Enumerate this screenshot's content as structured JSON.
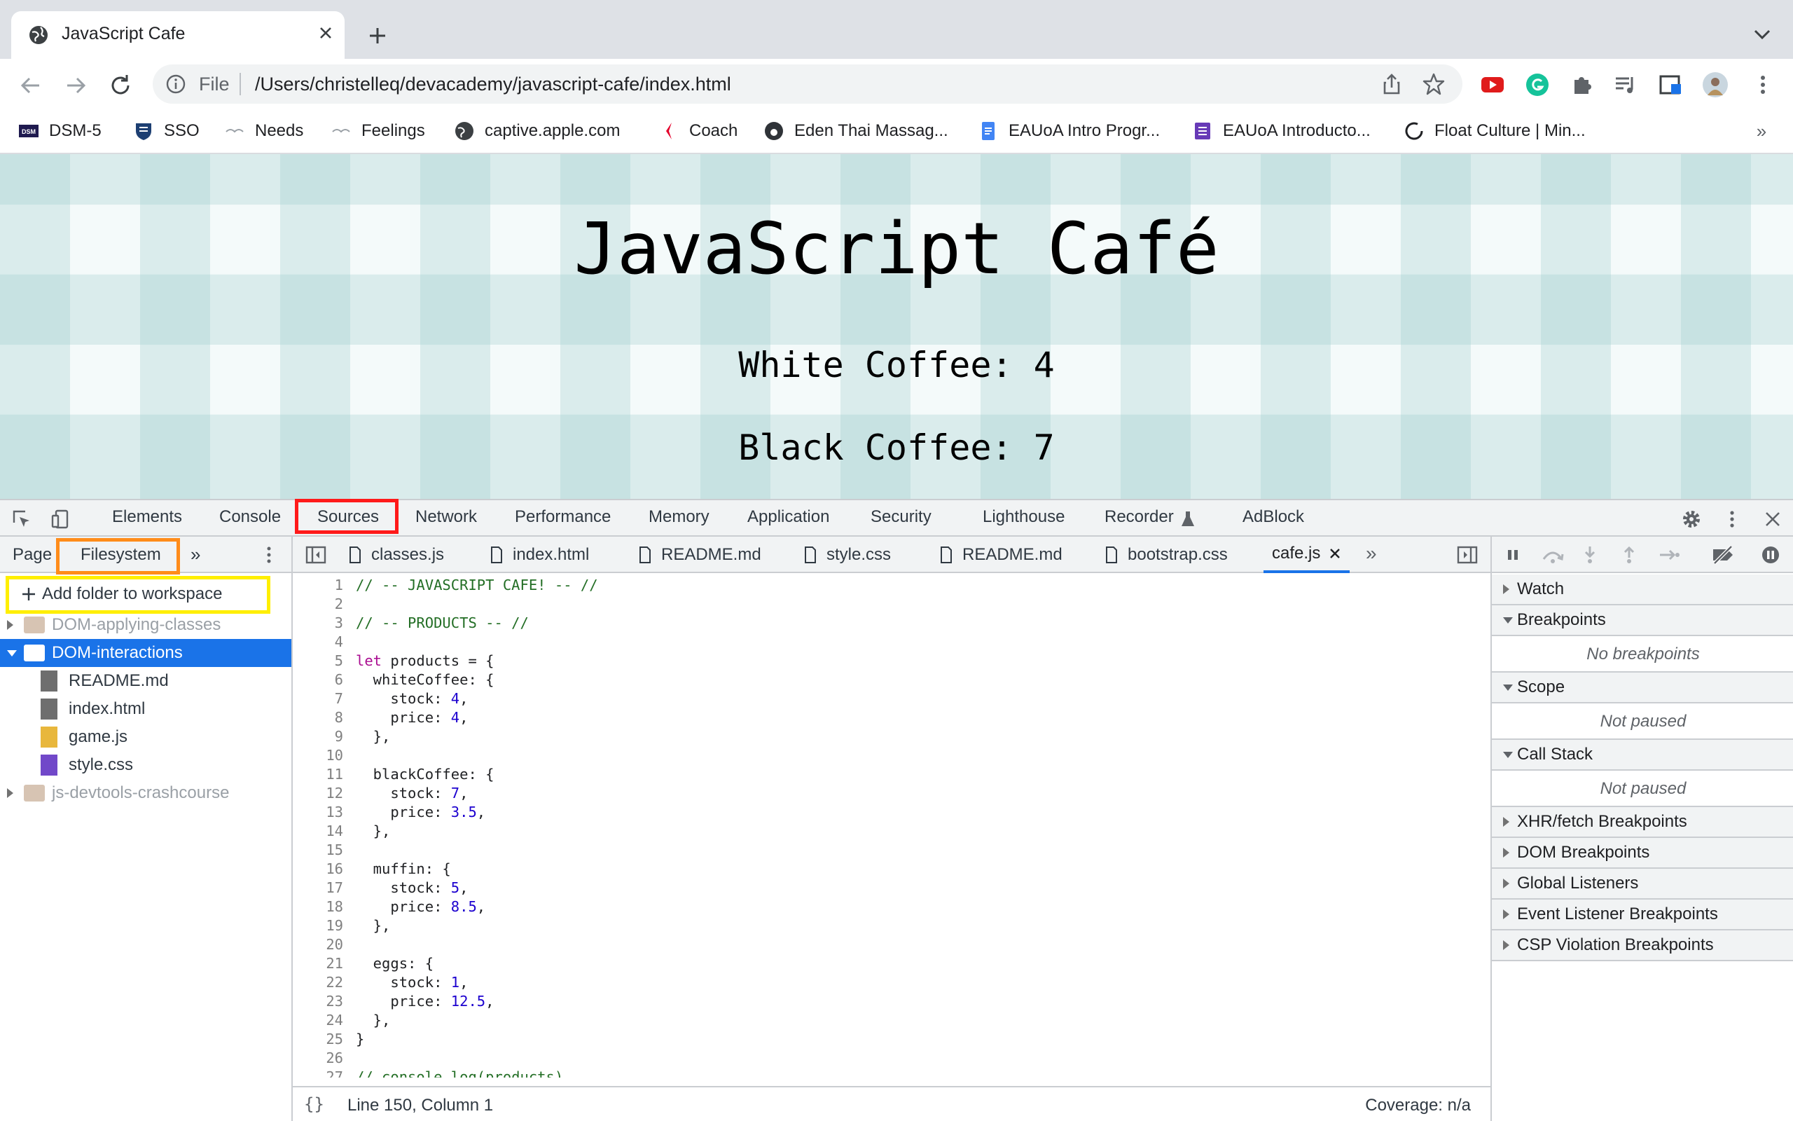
{
  "browser": {
    "tab_title": "JavaScript Cafe",
    "scheme_label": "File",
    "url": "/Users/christelleq/devacademy/javascript-cafe/index.html"
  },
  "bookmarks": [
    {
      "label": "DSM-5",
      "icon": "dsm-icon"
    },
    {
      "label": "SSO",
      "icon": "shield-crest-icon"
    },
    {
      "label": "Needs",
      "icon": "bird-icon"
    },
    {
      "label": "Feelings",
      "icon": "bird-icon"
    },
    {
      "label": "captive.apple.com",
      "icon": "globe-icon"
    },
    {
      "label": "Coach",
      "icon": "coach-icon"
    },
    {
      "label": "Eden Thai Massag...",
      "icon": "eden-icon"
    },
    {
      "label": "EAUoA Intro Progr...",
      "icon": "doc-icon"
    },
    {
      "label": "EAUoA Introducto...",
      "icon": "form-icon"
    },
    {
      "label": "Float Culture | Min...",
      "icon": "circle-icon"
    }
  ],
  "page": {
    "title": "JavaScript Café",
    "white_coffee": "White Coffee: 4",
    "black_coffee": "Black Coffee: 7"
  },
  "devtools": {
    "tabs": [
      "Elements",
      "Console",
      "Sources",
      "Network",
      "Performance",
      "Memory",
      "Application",
      "Security",
      "Lighthouse",
      "Recorder",
      "AdBlock"
    ],
    "active_tab": "Sources",
    "navigator": {
      "tabs": [
        "Page",
        "Filesystem"
      ],
      "add_folder": "Add folder to workspace",
      "tree": [
        {
          "label": "DOM-applying-classes",
          "type": "folder",
          "expanded": false
        },
        {
          "label": "DOM-interactions",
          "type": "folder",
          "expanded": true
        },
        {
          "label": "README.md",
          "type": "file"
        },
        {
          "label": "index.html",
          "type": "file"
        },
        {
          "label": "game.js",
          "type": "file"
        },
        {
          "label": "style.css",
          "type": "file"
        },
        {
          "label": "js-devtools-crashcourse",
          "type": "folder",
          "expanded": false
        }
      ]
    },
    "editor_tabs": [
      "classes.js",
      "index.html",
      "README.md",
      "style.css",
      "README.md",
      "bootstrap.css",
      "cafe.js"
    ],
    "active_editor_tab": "cafe.js",
    "status": {
      "position": "Line 150, Column 1",
      "coverage": "Coverage: n/a"
    },
    "debugger": {
      "sections": [
        {
          "label": "Watch",
          "expanded": false
        },
        {
          "label": "Breakpoints",
          "expanded": true,
          "body": "No breakpoints"
        },
        {
          "label": "Scope",
          "expanded": true,
          "body": "Not paused"
        },
        {
          "label": "Call Stack",
          "expanded": true,
          "body": "Not paused"
        },
        {
          "label": "XHR/fetch Breakpoints",
          "expanded": false
        },
        {
          "label": "DOM Breakpoints",
          "expanded": false
        },
        {
          "label": "Global Listeners",
          "expanded": false
        },
        {
          "label": "Event Listener Breakpoints",
          "expanded": false
        },
        {
          "label": "CSP Violation Breakpoints",
          "expanded": false
        }
      ]
    }
  },
  "code_lines": [
    "// -- JAVASCRIPT CAFE! -- //",
    "",
    "// -- PRODUCTS -- //",
    "",
    "let products = {",
    "  whiteCoffee: {",
    "    stock: 4,",
    "    price: 4,",
    "  },",
    "",
    "  blackCoffee: {",
    "    stock: 7,",
    "    price: 3.5,",
    "  },",
    "",
    "  muffin: {",
    "    stock: 5,",
    "    price: 8.5,",
    "  },",
    "",
    "  eggs: {",
    "    stock: 1,",
    "    price: 12.5,",
    "  },",
    "}",
    "",
    "// console.log(products)"
  ]
}
